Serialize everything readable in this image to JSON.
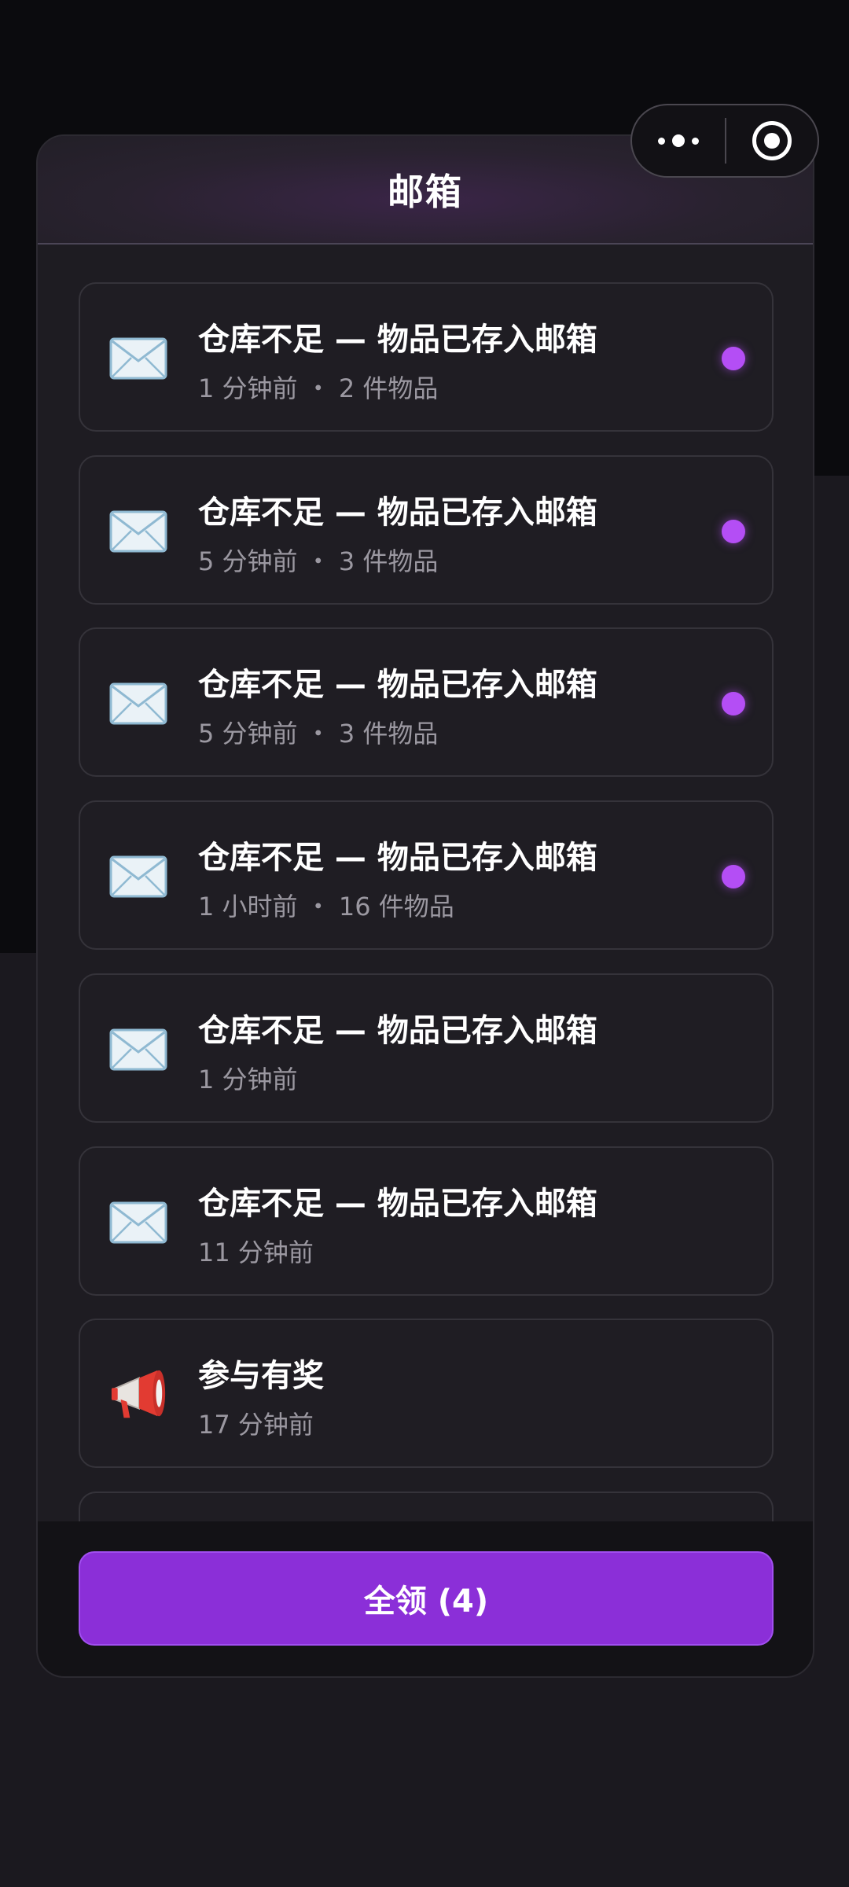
{
  "header": {
    "title": "邮箱"
  },
  "mails": [
    {
      "icon": "envelope-icon",
      "title": "仓库不足 — 物品已存入邮箱",
      "meta": "1 分钟前 ・ 2 件物品",
      "unread": true
    },
    {
      "icon": "envelope-icon",
      "title": "仓库不足 — 物品已存入邮箱",
      "meta": "5 分钟前 ・ 3 件物品",
      "unread": true
    },
    {
      "icon": "envelope-icon",
      "title": "仓库不足 — 物品已存入邮箱",
      "meta": "5 分钟前 ・ 3 件物品",
      "unread": true
    },
    {
      "icon": "envelope-icon",
      "title": "仓库不足 — 物品已存入邮箱",
      "meta": "1 小时前 ・ 16 件物品",
      "unread": true
    },
    {
      "icon": "envelope-icon",
      "title": "仓库不足 — 物品已存入邮箱",
      "meta": "1 分钟前",
      "unread": false
    },
    {
      "icon": "envelope-icon",
      "title": "仓库不足 — 物品已存入邮箱",
      "meta": "11 分钟前",
      "unread": false
    },
    {
      "icon": "megaphone-icon",
      "title": "参与有奖",
      "meta": "17 分钟前",
      "unread": false
    }
  ],
  "footer": {
    "claim_all_label": "全领 (4)"
  },
  "colors": {
    "accent": "#8b2fd8",
    "unread_dot": "#b44ef5",
    "background": "#1b191f"
  }
}
